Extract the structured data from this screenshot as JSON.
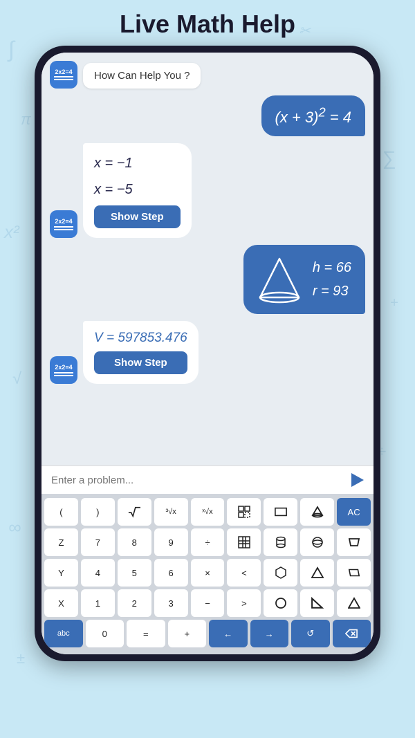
{
  "page": {
    "title": "Live Math Help",
    "background_color": "#c8e8f5"
  },
  "chat": {
    "greeting": "How Can Help You ?",
    "messages": [
      {
        "type": "user",
        "content": "(x + 3)² = 4"
      },
      {
        "type": "bot",
        "lines": [
          "x = −1",
          "x = −5"
        ],
        "button": "Show Step"
      },
      {
        "type": "user-cone",
        "h": "h = 66",
        "r": "r = 93"
      },
      {
        "type": "bot-vol",
        "content": "V = 597853.476",
        "button": "Show Step"
      }
    ]
  },
  "input": {
    "placeholder": "Enter a problem..."
  },
  "keyboard": {
    "rows": [
      [
        "(",
        ")",
        "√x",
        "³√x",
        "ˣ√x",
        "⊞",
        "▭",
        "△",
        "AC"
      ],
      [
        "Z",
        "7",
        "8",
        "9",
        "÷",
        "⊟",
        "⬭",
        "⊖",
        "⌓"
      ],
      [
        "Y",
        "4",
        "5",
        "6",
        "×",
        "<",
        "⬡",
        "△",
        "▱"
      ],
      [
        "X",
        "1",
        "2",
        "3",
        "-",
        ">",
        "○",
        "◁",
        "▲"
      ],
      [
        "abc",
        "0",
        "=",
        "+",
        "←",
        "→",
        "↺",
        "⌫"
      ]
    ]
  }
}
